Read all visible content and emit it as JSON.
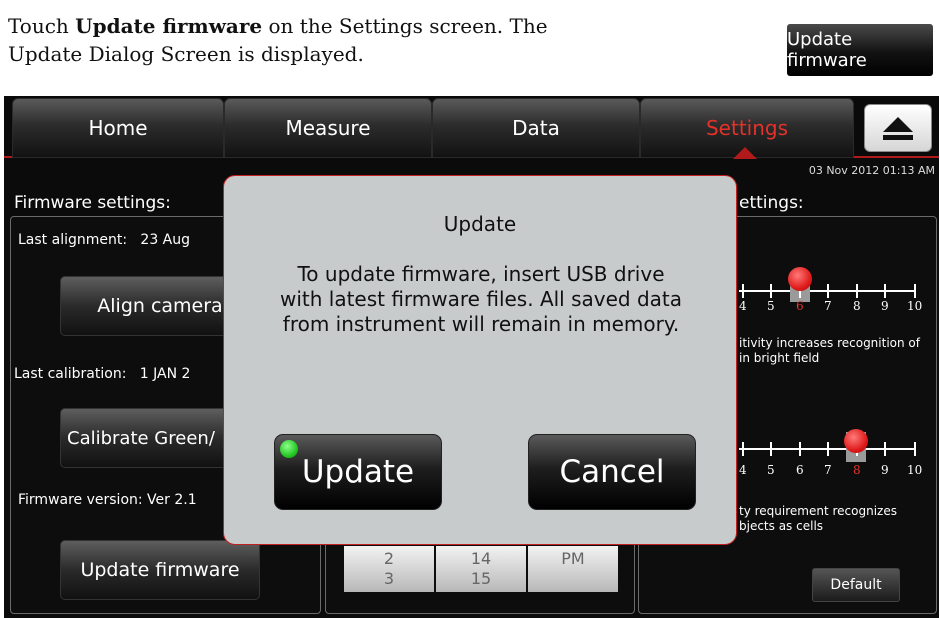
{
  "instruction": {
    "pre": "Touch ",
    "bold": "Update firmware",
    "post": " on the Settings screen. The Update Dialog Screen is displayed."
  },
  "sample_button": "Update firmware",
  "nav": {
    "tabs": [
      "Home",
      "Measure",
      "Data",
      "Settings"
    ],
    "active": "Settings",
    "accent_color": "#e4322b"
  },
  "datetime": "03 Nov 2012  01:13 AM",
  "left_panel": {
    "title": "Firmware settings:",
    "last_alignment_label": "Last alignment:",
    "last_alignment_value": "23 Aug",
    "align_button": "Align camera",
    "last_calibration_label": "Last calibration:",
    "last_calibration_value": "1 JAN 2",
    "calibrate_button": "Calibrate Green/",
    "firmware_version": "Firmware version: Ver 2.1",
    "update_button": "Update firmware"
  },
  "middle_picker": {
    "col1": [
      "2",
      "3"
    ],
    "col2": [
      "14",
      "15"
    ],
    "col3": [
      "PM"
    ]
  },
  "right_panel": {
    "title": "ettings:",
    "slider1": {
      "ticks": [
        "4",
        "5",
        "6",
        "7",
        "8",
        "9",
        "10"
      ],
      "selected": "6",
      "desc": [
        "itivity increases recognition of",
        "in bright field"
      ]
    },
    "slider2": {
      "ticks": [
        "4",
        "5",
        "6",
        "7",
        "8",
        "9",
        "10"
      ],
      "selected": "8",
      "desc": [
        "ty requirement recognizes",
        "bjects as cells"
      ]
    },
    "default_button": "Default"
  },
  "dialog": {
    "title": "Update",
    "message": "To update firmware, insert USB drive with latest firmware files. All saved data from instrument will remain in memory.",
    "update_button": "Update",
    "cancel_button": "Cancel",
    "led_color": "#1fc41f"
  }
}
